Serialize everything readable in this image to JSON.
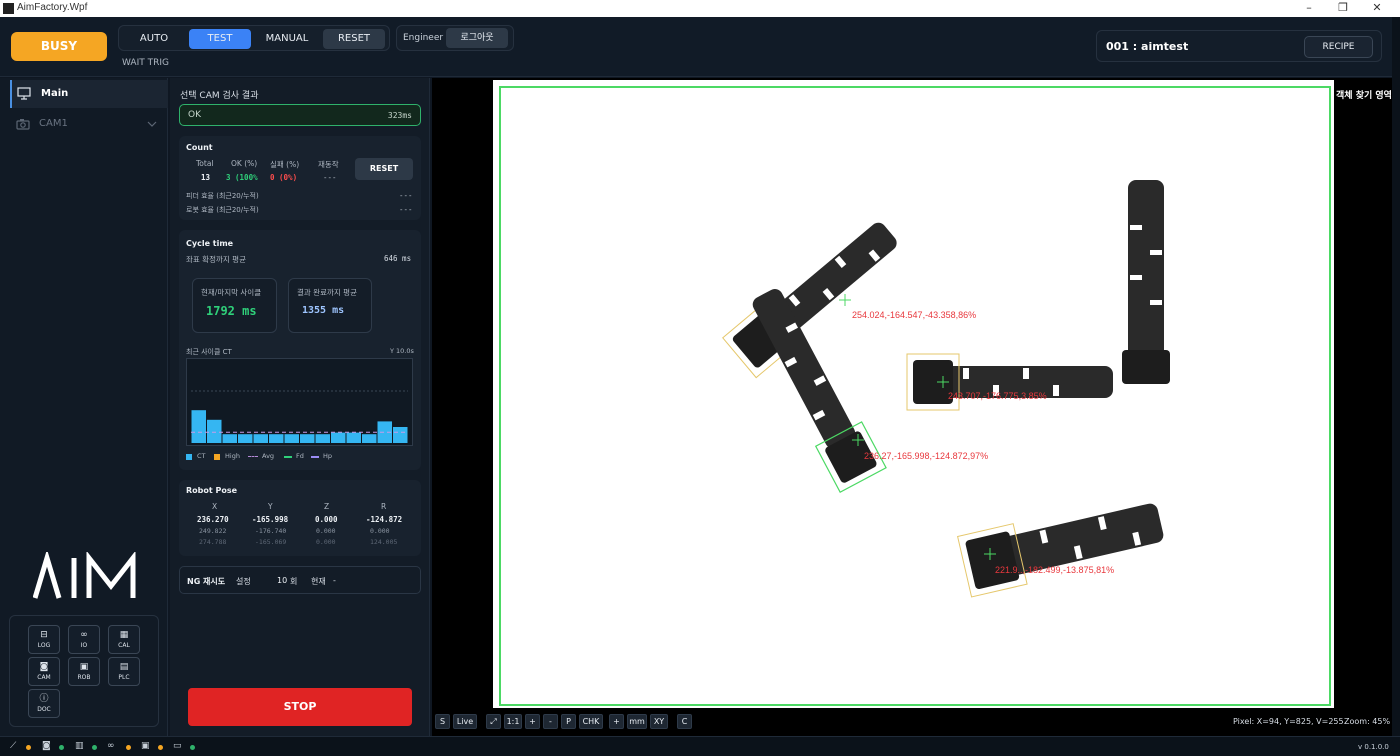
{
  "window": {
    "title": "AimFactory.Wpf",
    "minimize": "–",
    "maximize": "❐",
    "close": "✕"
  },
  "header": {
    "busy": "BUSY",
    "modes": [
      "AUTO",
      "TEST",
      "MANUAL",
      "RESET"
    ],
    "active_mode": "TEST",
    "wait_status": "WAIT TRIG",
    "role": "Engineer",
    "logout": "로그아웃",
    "recipe_name": "001 : aimtest",
    "recipe_button": "RECIPE"
  },
  "sidebar": {
    "items": [
      {
        "label": "Main",
        "icon": "monitor-icon",
        "active": true
      },
      {
        "label": "CAM1",
        "icon": "camera-icon",
        "active": false
      }
    ],
    "logo": "AIM",
    "tools": [
      {
        "label": "LOG",
        "icon": "log-icon"
      },
      {
        "label": "IO",
        "icon": "io-icon"
      },
      {
        "label": "CAL",
        "icon": "calendar-icon"
      },
      {
        "label": "CAM",
        "icon": "camera-icon"
      },
      {
        "label": "ROB",
        "icon": "robot-icon"
      },
      {
        "label": "PLC",
        "icon": "plc-icon"
      },
      {
        "label": "DOC",
        "icon": "info-icon"
      }
    ]
  },
  "result": {
    "title": "선택 CAM 검사 결과",
    "status": "OK",
    "time": "323ms"
  },
  "count": {
    "title": "Count",
    "headers": [
      "Total",
      "OK (%)",
      "실패 (%)",
      "재동작"
    ],
    "values": [
      "13",
      "3 (100%",
      "0 (0%)",
      "---"
    ],
    "reset": "RESET",
    "feeder_label": "피더 효율 (최근20/누적)",
    "feeder_value": "---",
    "robot_label": "로봇 효율 (최근20/누적)",
    "robot_value": "---"
  },
  "cycle": {
    "title": "Cycle time",
    "coord_label": "좌표 확정까지 평균",
    "coord_value": "646 ms",
    "current_label": "현재/마지막 사이클",
    "current_value": "1792 ms",
    "result_label": "결과 완료까지 평균",
    "result_value": "1355 ms",
    "chart_label": "최근 사이클 CT",
    "chart_ymax": "Y 10.0s",
    "legend": [
      "CT",
      "High",
      "Avg",
      "Fd",
      "Hp"
    ]
  },
  "robot_pose": {
    "title": "Robot Pose",
    "headers": [
      "X",
      "Y",
      "Z",
      "R"
    ],
    "rows": [
      [
        "236.270",
        "-165.998",
        "0.000",
        "-124.872"
      ],
      [
        "249.822",
        "-176.740",
        "0.000",
        "0.000"
      ],
      [
        "274.788",
        "-165.069",
        "0.000",
        "124.005"
      ]
    ]
  },
  "ng_retry": {
    "label": "NG 재시도",
    "setting_label": "설정",
    "setting_value": "10",
    "unit": "회",
    "current_label": "현재",
    "current_value": "-"
  },
  "stop": "STOP",
  "viewer": {
    "find_label": "객체 찾기 영역",
    "measurements": [
      "254.024,-164.547,-43.358,86%",
      "243.707,-176.775,3.85%",
      "236.27,-165.998,-124.872,97%",
      "221.9..,-182.499,-13.875,81%"
    ],
    "tools": [
      "S",
      "Live",
      "⤢",
      "1:1",
      "+",
      "-",
      "P",
      "CHK",
      "+",
      "mm",
      "XY",
      "C"
    ],
    "pixel_info": "Pixel: X=94, Y=825, V=255",
    "zoom": "Zoom: 45%"
  },
  "statusbar": {
    "version": "v 0.1.0.0",
    "indicators": [
      {
        "icon": "robot-arm-icon",
        "color": "#f5a623"
      },
      {
        "icon": "camera-icon",
        "color": "#2fb26b"
      },
      {
        "icon": "plc-icon",
        "color": "#2fb26b"
      },
      {
        "icon": "io-icon",
        "color": "#f5a623"
      },
      {
        "icon": "image-icon",
        "color": "#f5a623"
      },
      {
        "icon": "monitor-icon",
        "color": "#2fb26b"
      }
    ]
  },
  "chart_data": {
    "type": "bar",
    "title": "최근 사이클 CT",
    "ylim": [
      0,
      10
    ],
    "series": [
      {
        "name": "CT",
        "values": [
          4.1,
          2.9,
          1.1,
          1.1,
          1.1,
          1.1,
          1.1,
          1.1,
          1.1,
          1.3,
          1.3,
          1.1,
          2.7,
          2.0
        ]
      }
    ],
    "avg": 1.35,
    "high": 6.5
  }
}
